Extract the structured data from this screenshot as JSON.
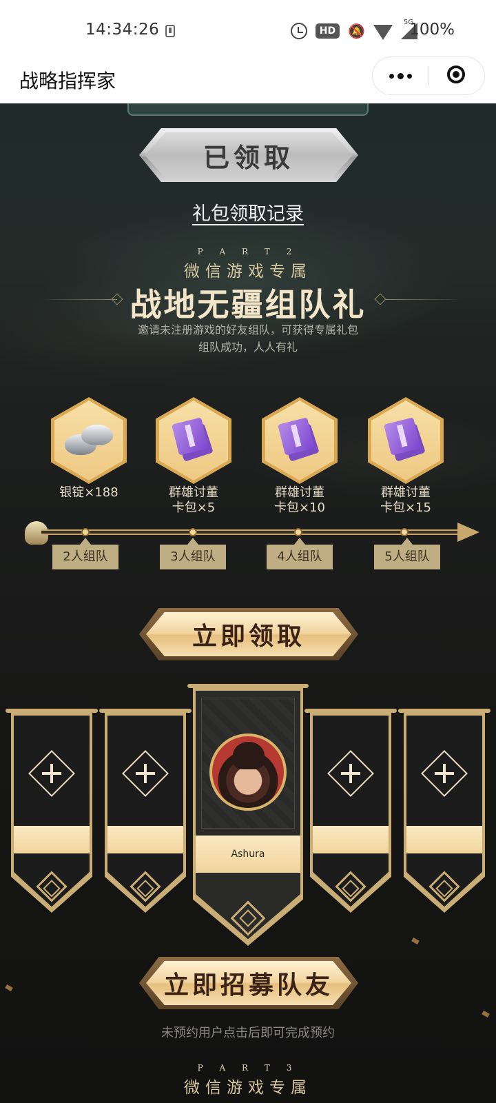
{
  "status_bar": {
    "time": "14:34:26",
    "hd_badge": "HD",
    "network": "5G",
    "battery": "100%"
  },
  "title_bar": {
    "title": "战略指挥家",
    "icons": [
      "more-dots-icon",
      "close-target-icon"
    ]
  },
  "part1": {
    "claimed_button": "已领取",
    "record_link": "礼包领取记录"
  },
  "part2": {
    "part_label": "P A R T 2",
    "subtitle": "微信游戏专属",
    "title": "战地无疆组队礼",
    "desc_line1": "邀请未注册游戏的好友组队，可获得专属礼包",
    "desc_line2": "组队成功，人人有礼",
    "rewards": [
      {
        "line1": "银锭×188",
        "line2": "",
        "icon": "silver-ingot-icon"
      },
      {
        "line1": "群雄讨董",
        "line2": "卡包×5",
        "icon": "card-pack-icon"
      },
      {
        "line1": "群雄讨董",
        "line2": "卡包×10",
        "icon": "card-pack-icon"
      },
      {
        "line1": "群雄讨董",
        "line2": "卡包×15",
        "icon": "card-pack-icon"
      }
    ],
    "tiers": [
      "2人组队",
      "3人组队",
      "4人组队",
      "5人组队"
    ],
    "claim_button": "立即领取",
    "team": {
      "leader_name": "Ashura",
      "empty_slots": 4
    },
    "recruit_button": "立即招募队友",
    "recruit_hint": "未预约用户点击后即可完成预约"
  },
  "part3": {
    "part_label": "P A R T 3",
    "subtitle": "微信游戏专属"
  },
  "colors": {
    "gold": "#c9ad74",
    "button_text": "#3b2417",
    "background": "#1a1b1a"
  }
}
